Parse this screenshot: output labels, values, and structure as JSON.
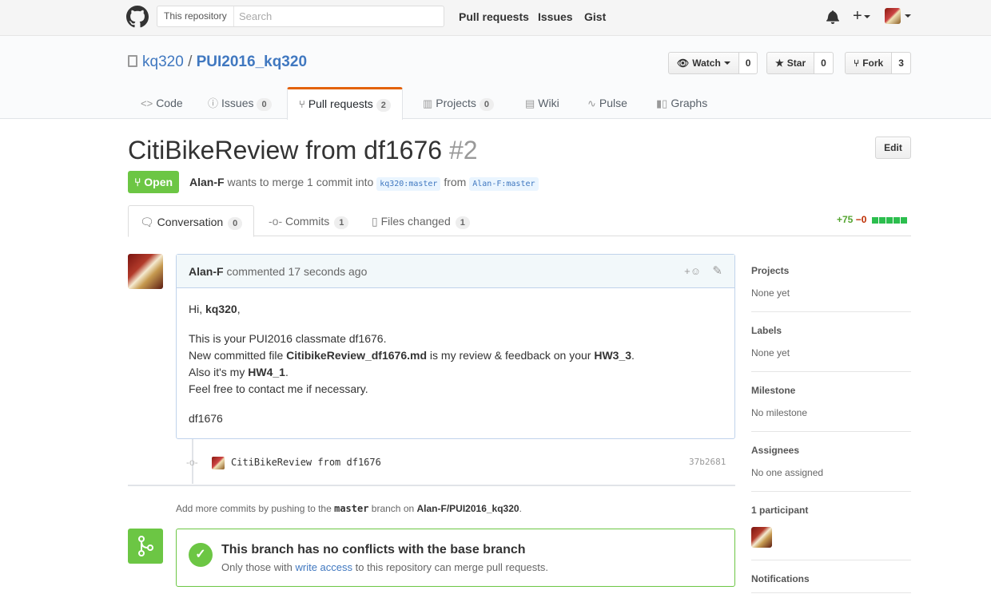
{
  "header": {
    "search_scope": "This repository",
    "search_placeholder": "Search",
    "nav": [
      "Pull requests",
      "Issues",
      "Gist"
    ]
  },
  "repo": {
    "owner": "kq320",
    "separator": "/",
    "name": "PUI2016_kq320",
    "watch_label": "Watch",
    "watch_count": "0",
    "star_label": "Star",
    "star_count": "0",
    "fork_label": "Fork",
    "fork_count": "3",
    "tabs": [
      {
        "label": "Code",
        "icon": "code-icon"
      },
      {
        "label": "Issues",
        "count": "0",
        "icon": "issue-icon"
      },
      {
        "label": "Pull requests",
        "count": "2",
        "icon": "pull-request-icon",
        "selected": true
      },
      {
        "label": "Projects",
        "count": "0",
        "icon": "project-icon"
      },
      {
        "label": "Wiki",
        "icon": "book-icon"
      },
      {
        "label": "Pulse",
        "icon": "pulse-icon"
      },
      {
        "label": "Graphs",
        "icon": "graph-icon"
      }
    ]
  },
  "pr": {
    "title": "CitiBikeReview from df1676",
    "number": "#2",
    "edit_label": "Edit",
    "state": "Open",
    "author": "Alan-F",
    "merge_text": "wants to merge 1 commit into",
    "base_ref": "kq320:master",
    "from_text": "from",
    "head_ref": "Alan-F:master",
    "tabs": [
      {
        "label": "Conversation",
        "count": "0"
      },
      {
        "label": "Commits",
        "count": "1"
      },
      {
        "label": "Files changed",
        "count": "1"
      }
    ],
    "additions": "+75",
    "deletions": "−0"
  },
  "comment": {
    "author": "Alan-F",
    "action": "commented",
    "time": "17 seconds ago",
    "greeting_pre": "Hi, ",
    "greeting_name": "kq320",
    "greeting_post": ",",
    "line1": "This is your PUI2016 classmate df1676.",
    "line2_pre": "New committed file ",
    "line2_file": "CitibikeReview_df1676.md",
    "line2_mid": " is my review & feedback on your ",
    "line2_hw": "HW3_3",
    "line2_post": ".",
    "line3_pre": "Also it's my ",
    "line3_hw": "HW4_1",
    "line3_post": ".",
    "line4": "Feel free to contact me if necessary.",
    "signature": "df1676"
  },
  "commit": {
    "message": "CitiBikeReview from df1676",
    "sha": "37b2681"
  },
  "push_hint": {
    "pre": "Add more commits by pushing to the ",
    "branch": "master",
    "mid": " branch on ",
    "repo": "Alan-F/PUI2016_kq320",
    "post": "."
  },
  "merge": {
    "title": "This branch has no conflicts with the base branch",
    "sub_pre": "Only those with ",
    "sub_link": "write access",
    "sub_post": " to this repository can merge pull requests."
  },
  "sidebar": {
    "projects_h": "Projects",
    "projects_v": "None yet",
    "labels_h": "Labels",
    "labels_v": "None yet",
    "milestone_h": "Milestone",
    "milestone_v": "No milestone",
    "assignees_h": "Assignees",
    "assignees_v": "No one assigned",
    "participants_h": "1 participant",
    "notifications_h": "Notifications"
  },
  "colors": {
    "open_green": "#6cc644",
    "link_blue": "#4078c0",
    "tab_accent": "#e36209"
  }
}
